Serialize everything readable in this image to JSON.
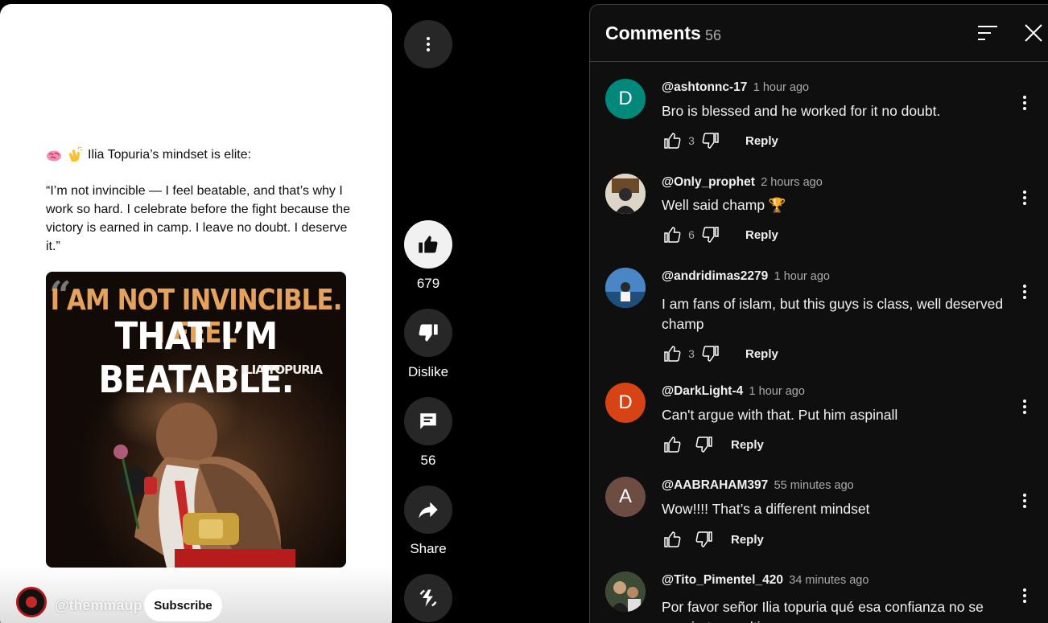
{
  "post": {
    "intro": "Ilia Topuria’s mindset is elite:",
    "quote": "“I’m not invincible — I feel beatable, and that’s why I work so hard. I celebrate before the fight because the victory is earned in camp. I leave no doubt. I deserve it.”",
    "image_headline_1": "I AM NOT INVINCIBLE. I FEEL",
    "image_headline_2": "THAT I’M BEATABLE.",
    "image_byline": "- ILIA TOPURIA"
  },
  "channel": {
    "handle": "@themmaup",
    "subscribe_label": "Subscribe"
  },
  "actions": {
    "like_count": "679",
    "dislike_label": "Dislike",
    "comments_count": "56",
    "share_label": "Share"
  },
  "comments_panel": {
    "title": "Comments",
    "count": "56",
    "items": [
      {
        "author": "@ashtonnc-17",
        "time": "1 hour ago",
        "text": "Bro is blessed and he worked for it no doubt.",
        "likes": "3",
        "reply": "Reply",
        "avatar_letter": "D",
        "avatar_color": "#00897b"
      },
      {
        "author": "@Only_prophet",
        "time": "2 hours ago",
        "text": "Well said champ 🏆",
        "likes": "6",
        "reply": "Reply",
        "avatar_letter": "",
        "avatar_color": "#e8e2d6"
      },
      {
        "author": "@andridimas2279",
        "time": "1 hour ago",
        "text": "I am fans of islam, but this guys is class, well deserved champ",
        "likes": "3",
        "reply": "Reply",
        "avatar_letter": "",
        "avatar_color": "#3b6fa8"
      },
      {
        "author": "@DarkLight-4",
        "time": "1 hour ago",
        "text": "Can't argue with that. Put him aspinall",
        "likes": "",
        "reply": "Reply",
        "avatar_letter": "D",
        "avatar_color": "#d84315"
      },
      {
        "author": "@AABRAHAM397",
        "time": "55 minutes ago",
        "text": "Wow!!!! That’s a different mindset",
        "likes": "",
        "reply": "Reply",
        "avatar_letter": "A",
        "avatar_color": "#6d4c41"
      },
      {
        "author": "@Tito_Pimentel_420",
        "time": "34 minutes ago",
        "text": "Por favor señor Ilia topuria qué esa confianza no se convierta en altivez",
        "likes": "",
        "reply": "Reply",
        "avatar_letter": "",
        "avatar_color": "#5a6b4a"
      }
    ]
  },
  "icons": {
    "more": "more-vert-icon",
    "like": "thumb-up-icon",
    "dislike": "thumb-down-icon",
    "comment": "comment-icon",
    "share": "share-icon",
    "remix": "remix-icon",
    "sort": "sort-icon",
    "close": "close-icon"
  }
}
